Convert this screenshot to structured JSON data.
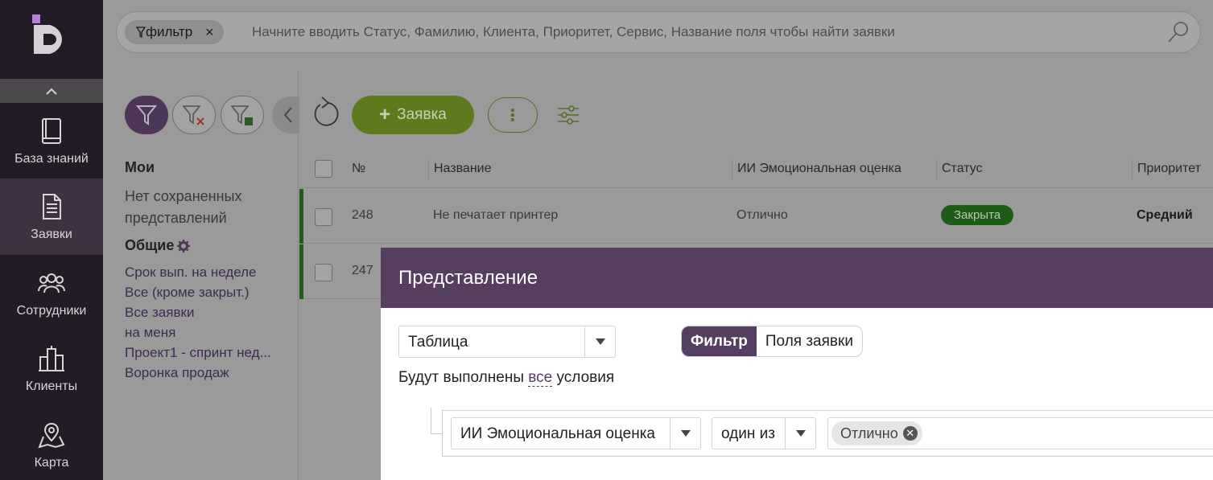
{
  "nav": {
    "items": [
      {
        "label": "База знаний",
        "icon": "book-icon"
      },
      {
        "label": "Заявки",
        "icon": "document-icon"
      },
      {
        "label": "Сотрудники",
        "icon": "people-icon"
      },
      {
        "label": "Клиенты",
        "icon": "buildings-icon"
      },
      {
        "label": "Карта",
        "icon": "map-icon"
      }
    ],
    "active": "Заявки"
  },
  "search": {
    "chip_label": "фильтр",
    "chip_close": "×",
    "placeholder": "Начните вводить Статус, Фамилию, Клиента, Приоритет, Сервис, Название поля чтобы найти заявки"
  },
  "views": {
    "mine_heading": "Мои",
    "mine_empty_line1": "Нет сохраненных",
    "mine_empty_line2": "представлений",
    "common_heading": "Общие",
    "common_items": [
      "Срок вып. на неделе",
      "Все (кроме закрыт.)",
      "Все заявки",
      "на меня",
      "Проект1 - спринт нед...",
      "Воронка продаж"
    ]
  },
  "toolbar": {
    "add_label": "Заявка",
    "add_plus": "+",
    "more_label": "⋮"
  },
  "table": {
    "headers": {
      "number": "№",
      "title": "Название",
      "ai": "ИИ Эмоциональная оценка",
      "status": "Статус",
      "priority": "Приоритет"
    },
    "rows": [
      {
        "number": "248",
        "title": "Не печатает принтер",
        "ai": "Отлично",
        "status": "Закрыта",
        "priority": "Средний"
      },
      {
        "number": "247"
      }
    ]
  },
  "modal": {
    "title": "Представление",
    "view_type": "Таблица",
    "tabs": {
      "filter": "Фильтр",
      "fields": "Поля заявки"
    },
    "cond_prefix": "Будут выполнены",
    "cond_all": "все",
    "cond_suffix": "условия",
    "condition": {
      "field": "ИИ Эмоциональная оценка",
      "operator": "один из",
      "value_tag": "Отлично"
    }
  },
  "colors": {
    "nav_bg": "#231b25",
    "accent_purple": "#563e61",
    "add_green": "#5d7a1e",
    "status_closed": "#1e5d18"
  }
}
